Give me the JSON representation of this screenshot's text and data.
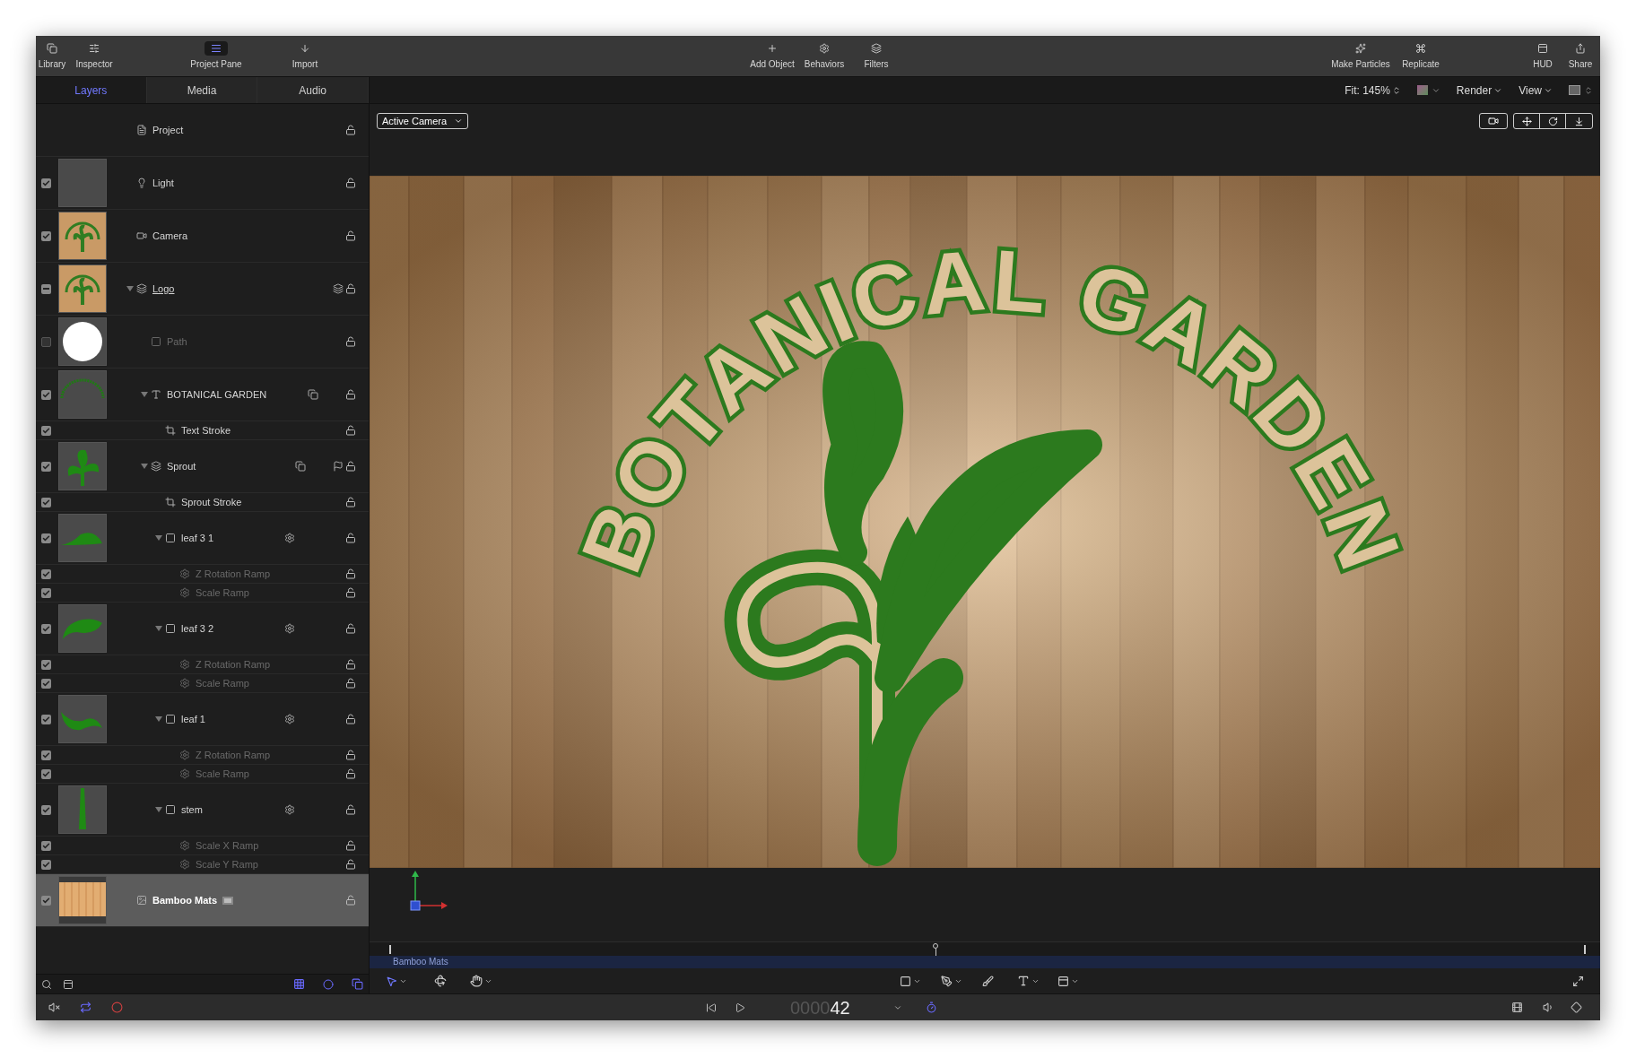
{
  "toolbar": {
    "left": [
      {
        "kind": "library",
        "label": "Library",
        "selected": false
      },
      {
        "kind": "inspector",
        "label": "Inspector",
        "selected": false
      },
      {
        "kind": "pane",
        "label": "Project Pane",
        "selected": true
      },
      {
        "kind": "import",
        "label": "Import",
        "selected": false
      }
    ],
    "center": [
      {
        "kind": "add",
        "label": "Add Object"
      },
      {
        "kind": "behaviors",
        "label": "Behaviors"
      },
      {
        "kind": "filters",
        "label": "Filters"
      }
    ],
    "right": [
      {
        "kind": "particles",
        "label": "Make Particles"
      },
      {
        "kind": "replicate",
        "label": "Replicate"
      },
      {
        "kind": "hud",
        "label": "HUD"
      },
      {
        "kind": "share",
        "label": "Share"
      }
    ]
  },
  "tabs": [
    {
      "label": "Layers",
      "selected": true
    },
    {
      "label": "Media",
      "selected": false
    },
    {
      "label": "Audio",
      "selected": false
    }
  ],
  "viewer_bar": {
    "fit": "Fit: 145%",
    "render": "Render",
    "view": "View"
  },
  "camera_menu": "Active Camera",
  "layers": [
    {
      "kind": "project",
      "name": "Project",
      "selected": false
    },
    {
      "kind": "light",
      "name": "Light",
      "checked": true,
      "partial": false,
      "selected": false
    },
    {
      "kind": "camera",
      "name": "Camera",
      "checked": true,
      "partial": false,
      "selected": false
    },
    {
      "kind": "group",
      "name": "Logo",
      "checked": true,
      "partial": true,
      "expanded": true,
      "selected": false,
      "children": [
        {
          "kind": "shape",
          "name": "Path",
          "checked": false,
          "partial": false,
          "selected": false
        },
        {
          "kind": "text",
          "name": "BOTANICAL GARDEN",
          "checked": true,
          "partial": false,
          "expanded": true,
          "selected": false,
          "children": [
            {
              "kind": "stroke",
              "name": "Text Stroke",
              "checked": true,
              "partial": false,
              "selected": false
            }
          ]
        },
        {
          "kind": "group",
          "name": "Sprout",
          "checked": true,
          "partial": false,
          "expanded": true,
          "selected": false,
          "children": [
            {
              "kind": "stroke",
              "name": "Sprout Stroke",
              "checked": true,
              "partial": false,
              "selected": false
            },
            {
              "kind": "shape",
              "name": "leaf 3 1",
              "checked": true,
              "partial": false,
              "expanded": true,
              "selected": false,
              "children": [
                {
                  "kind": "behavior",
                  "name": "Z Rotation Ramp",
                  "checked": true,
                  "partial": false,
                  "selected": false
                },
                {
                  "kind": "behavior",
                  "name": "Scale Ramp",
                  "checked": true,
                  "partial": false,
                  "selected": false
                }
              ]
            },
            {
              "kind": "shape",
              "name": "leaf 3 2",
              "checked": true,
              "partial": false,
              "expanded": true,
              "selected": false,
              "children": [
                {
                  "kind": "behavior",
                  "name": "Z Rotation Ramp",
                  "checked": true,
                  "partial": false,
                  "selected": false
                },
                {
                  "kind": "behavior",
                  "name": "Scale Ramp",
                  "checked": true,
                  "partial": false,
                  "selected": false
                }
              ]
            },
            {
              "kind": "shape",
              "name": "leaf 1",
              "checked": true,
              "partial": false,
              "expanded": true,
              "selected": false,
              "children": [
                {
                  "kind": "behavior",
                  "name": "Z Rotation Ramp",
                  "checked": true,
                  "partial": false,
                  "selected": false
                },
                {
                  "kind": "behavior",
                  "name": "Scale Ramp",
                  "checked": true,
                  "partial": false,
                  "selected": false
                }
              ]
            },
            {
              "kind": "shape",
              "name": "stem",
              "checked": true,
              "partial": false,
              "expanded": true,
              "selected": false,
              "children": [
                {
                  "kind": "behavior",
                  "name": "Scale X Ramp",
                  "checked": true,
                  "partial": false,
                  "selected": false
                },
                {
                  "kind": "behavior",
                  "name": "Scale Y Ramp",
                  "checked": true,
                  "partial": false,
                  "selected": false
                }
              ]
            }
          ]
        }
      ]
    },
    {
      "kind": "image",
      "name": "Bamboo Mats",
      "checked": true,
      "partial": false,
      "selected": true
    }
  ],
  "canvas": {
    "title_art": "BOTANICAL GARDEN"
  },
  "timeline": {
    "track": "Bamboo Mats"
  },
  "transport": {
    "timecode": "000042"
  }
}
